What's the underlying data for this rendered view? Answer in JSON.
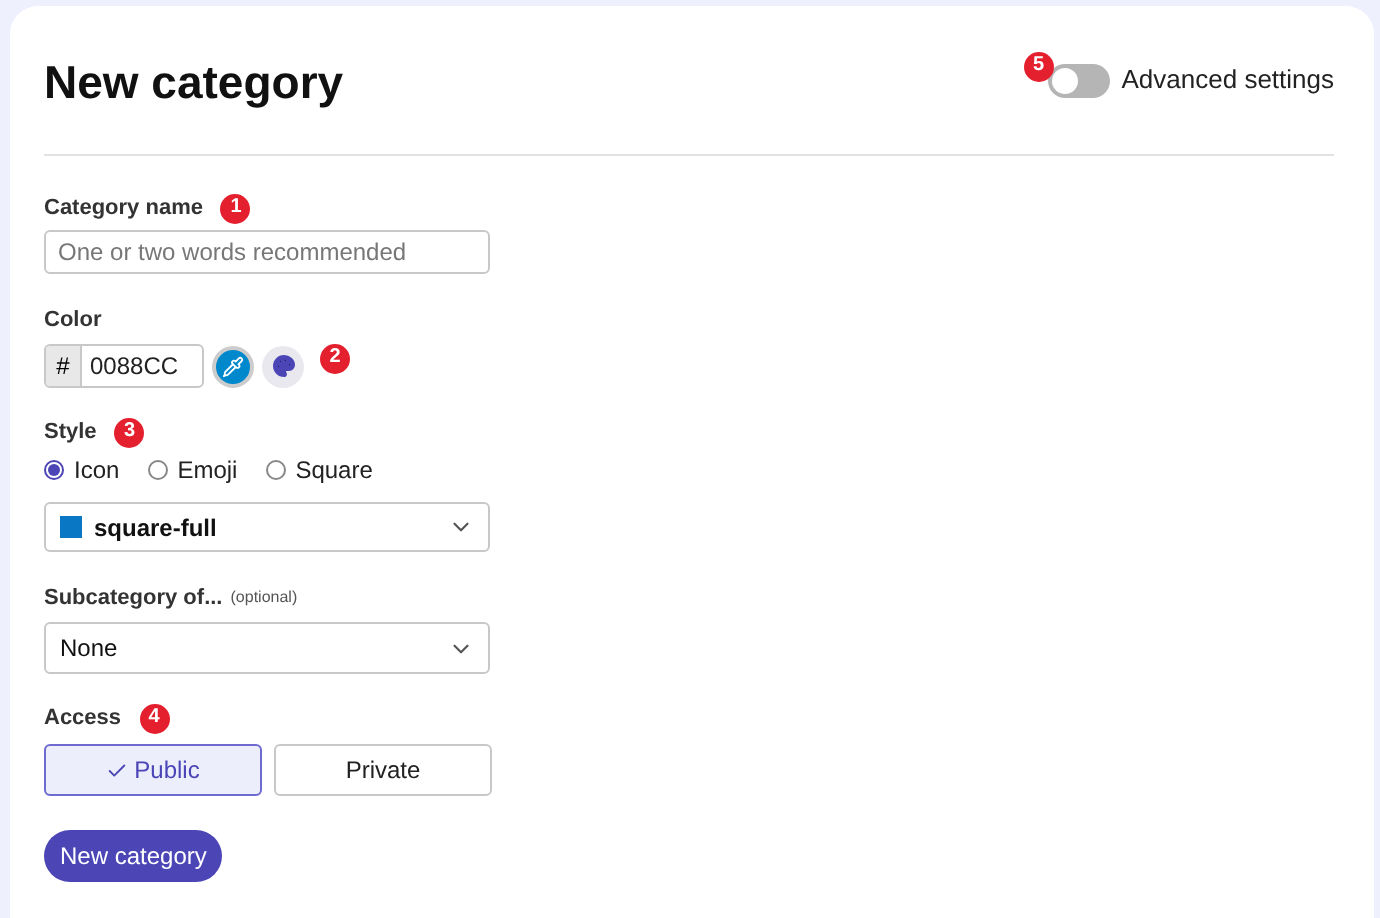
{
  "title": "New category",
  "advanced": {
    "label": "Advanced settings",
    "on": false,
    "badge": "5"
  },
  "name_field": {
    "label": "Category name",
    "badge": "1",
    "placeholder": "One or two words recommended"
  },
  "color_field": {
    "label": "Color",
    "badge": "2",
    "prefix": "#",
    "value": "0088CC",
    "color": "#0088cc"
  },
  "style_field": {
    "label": "Style",
    "badge": "3",
    "options": [
      {
        "label": "Icon",
        "selected": true
      },
      {
        "label": "Emoji",
        "selected": false
      },
      {
        "label": "Square",
        "selected": false
      }
    ],
    "icon_value": "square-full"
  },
  "parent_field": {
    "label": "Subcategory of...",
    "note": "(optional)",
    "value": "None"
  },
  "access_field": {
    "label": "Access",
    "badge": "4",
    "options": [
      {
        "label": "Public",
        "selected": true
      },
      {
        "label": "Private",
        "selected": false
      }
    ]
  },
  "submit": "New category"
}
